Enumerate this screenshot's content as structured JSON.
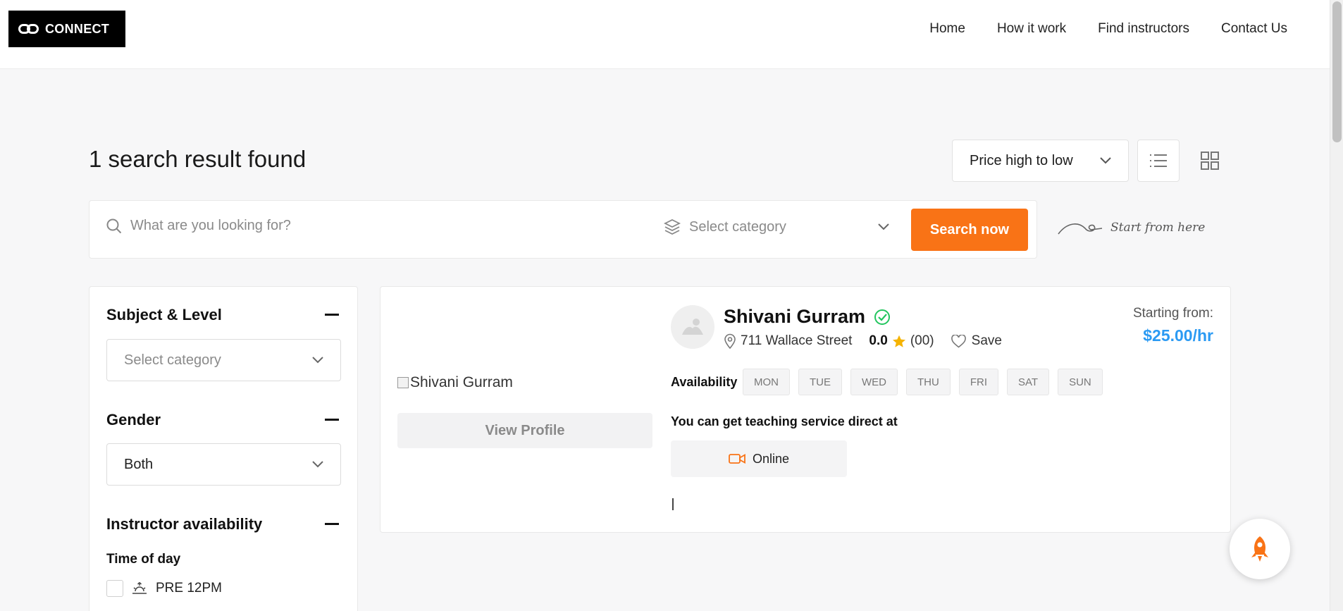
{
  "header": {
    "logo_text": "CONNECT",
    "nav": [
      "Home",
      "How it work",
      "Find instructors",
      "Contact Us"
    ]
  },
  "results": {
    "title": "1 search result found",
    "sort_value": "Price high to low"
  },
  "search": {
    "placeholder": "What are you looking for?",
    "category_placeholder": "Select category",
    "button_label": "Search now",
    "hint": "Start from here"
  },
  "filters": {
    "subject_title": "Subject & Level",
    "subject_select": "Select category",
    "gender_title": "Gender",
    "gender_value": "Both",
    "availability_title": "Instructor availability",
    "time_of_day_label": "Time of day",
    "time_options": [
      "PRE 12PM"
    ]
  },
  "instructor": {
    "image_alt": "Shivani Gurram",
    "view_profile_label": "View Profile",
    "name": "Shivani Gurram",
    "address": "711 Wallace Street",
    "rating": "0.0",
    "reviews": "(00)",
    "save_label": "Save",
    "price_label": "Starting from:",
    "price_value": "$25.00/hr",
    "availability_label": "Availability",
    "days": [
      "MON",
      "TUE",
      "WED",
      "THU",
      "FRI",
      "SAT",
      "SUN"
    ],
    "teaching_text": "You can get teaching service direct at",
    "mode": "Online"
  },
  "colors": {
    "accent": "#f97316",
    "price": "#2b9af3",
    "verified": "#22c55e",
    "star": "#f5b301"
  }
}
